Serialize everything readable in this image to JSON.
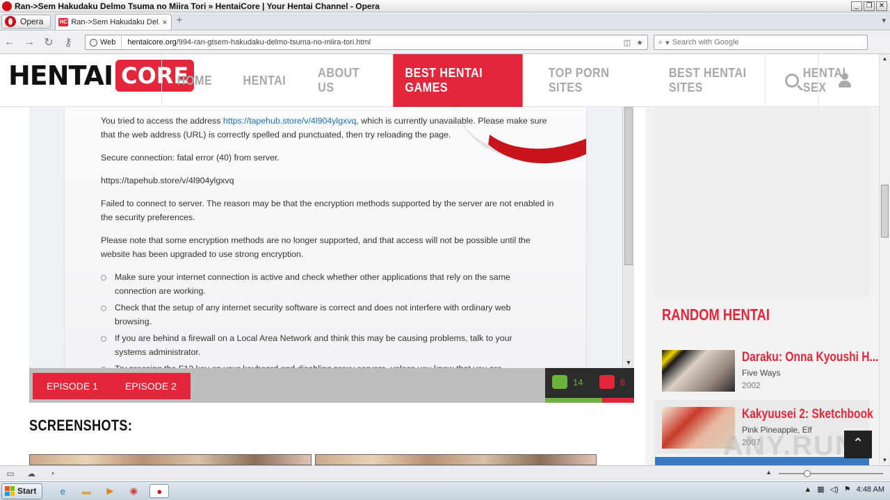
{
  "window": {
    "title": "Ran->Sem Hakudaku Delmo Tsuma no Miira Tori » HentaiCore | Your Hentai Channel - Opera",
    "minimize": "_",
    "restore": "❐",
    "close": "✕"
  },
  "tabs": {
    "menu_label": "Opera",
    "active_tab": "Ran->Sem Hakudaku Del...",
    "favicon_text": "HC",
    "close_glyph": "×",
    "new_tab_glyph": "+"
  },
  "addressbar": {
    "web_label": "Web",
    "url_domain": "hentaicore.org",
    "url_path": "/994-ran-gtsem-hakudaku-delmo-tsuma-no-miira-tori.html",
    "search_placeholder": "Search with Google"
  },
  "site": {
    "brand_left": "HENTAI",
    "brand_right": "CORE",
    "nav": [
      "HOME",
      "HENTAI",
      "ABOUT US",
      "BEST HENTAI GAMES",
      "TOP PORN SITES",
      "BEST HENTAI SITES",
      "HENTAI SEX"
    ],
    "nav_active_index": 3
  },
  "error_page": {
    "p1_before": "You tried to access the address ",
    "p1_link": "https://tapehub.store/v/4l904ylgxvq",
    "p1_after": ", which is currently unavailable. Please make sure that the web address (URL) is correctly spelled and punctuated, then try reloading the page.",
    "p2": "Secure connection: fatal error (40) from server.",
    "p3": "https://tapehub.store/v/4l904ylgxvq",
    "p4": "Failed to connect to server. The reason may be that the encryption methods supported by the server are not enabled in the security preferences.",
    "p5": "Please note that some encryption methods are no longer supported, and that access will not be possible until the website has been upgraded to use strong encryption.",
    "bullets": [
      "Make sure your internet connection is active and check whether other applications that rely on the same connection are working.",
      "Check that the setup of any internet security software is correct and does not interfere with ordinary web browsing.",
      "If you are behind a firewall on a Local Area Network and think this may be causing problems, talk to your systems administrator.",
      "Try pressing the F12 key on your keyboard and disabling proxy servers, unless you know that you are"
    ]
  },
  "episodes": [
    "EPISODE 1",
    "EPISODE 2"
  ],
  "votes": {
    "likes": "14",
    "dislikes": "8"
  },
  "screenshots_title": "SCREENSHOTS:",
  "sidebar": {
    "random_title": "RANDOM HENTAI",
    "items": [
      {
        "title": "Daraku: Onna Kyoushi H...",
        "studio": "Five Ways",
        "year": "2002"
      },
      {
        "title": "Kakyuusei 2: Sketchbook",
        "studio": "Pink Pineapple, Elf",
        "year": "2007"
      }
    ]
  },
  "watermark": "ANY.RUN",
  "taskbar": {
    "start_label": "Start",
    "clock": "4:48 AM"
  },
  "colors": {
    "accent": "#e3263a",
    "like": "#6cb33e",
    "dislike": "#e3263a"
  }
}
